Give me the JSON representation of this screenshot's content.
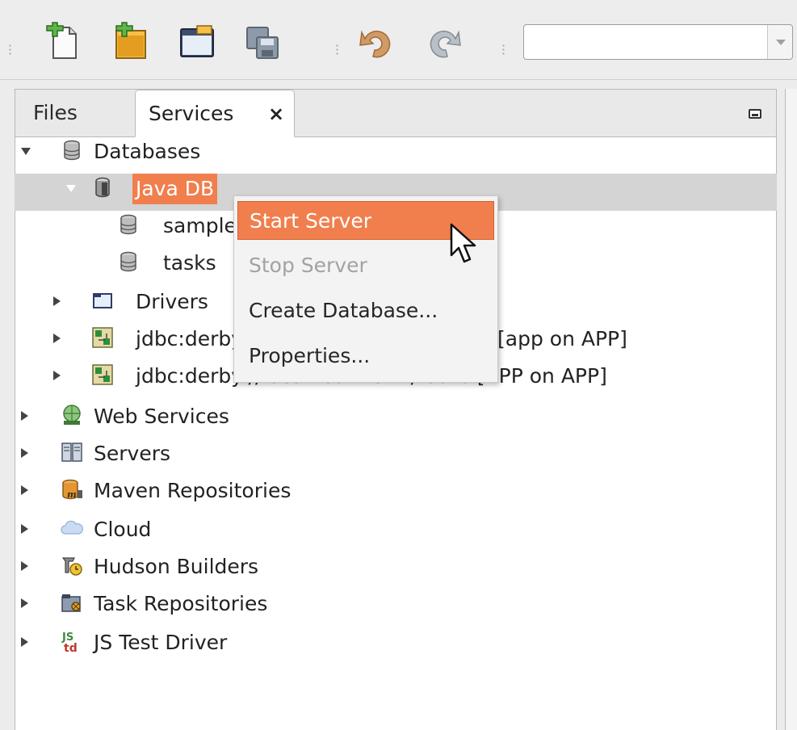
{
  "toolbar": {
    "buttons": [
      {
        "name": "new-file-icon"
      },
      {
        "name": "new-project-icon"
      },
      {
        "name": "open-project-icon"
      },
      {
        "name": "save-all-icon"
      },
      {
        "name": "undo-icon"
      },
      {
        "name": "redo-icon"
      }
    ],
    "search_value": ""
  },
  "tabs": [
    {
      "label": "Files",
      "active": false
    },
    {
      "label": "Services",
      "active": true,
      "close": "×"
    }
  ],
  "tree": [
    {
      "label": "Databases",
      "icon": "database-icon",
      "depth": 0,
      "expanded": true
    },
    {
      "label": "Java DB",
      "icon": "java-db-icon",
      "depth": 1,
      "expanded": true,
      "selected": true
    },
    {
      "label": "sample",
      "icon": "database-icon",
      "depth": 2
    },
    {
      "label": "tasks",
      "icon": "database-icon",
      "depth": 2
    },
    {
      "label": "Drivers",
      "icon": "folder-icon",
      "depth": 1,
      "expanded": false
    },
    {
      "label": "jdbc:derby://localhost:1527/sample [app on APP]",
      "icon": "connection-icon",
      "depth": 1,
      "expanded": false
    },
    {
      "label": "jdbc:derby://localhost:1527/tasks [APP on APP]",
      "icon": "connection-icon",
      "depth": 1,
      "expanded": false
    },
    {
      "label": "Web Services",
      "icon": "web-services-icon",
      "depth": 0,
      "expanded": false
    },
    {
      "label": "Servers",
      "icon": "servers-icon",
      "depth": 0,
      "expanded": false
    },
    {
      "label": "Maven Repositories",
      "icon": "maven-icon",
      "depth": 0,
      "expanded": false
    },
    {
      "label": "Cloud",
      "icon": "cloud-icon",
      "depth": 0,
      "expanded": false
    },
    {
      "label": "Hudson Builders",
      "icon": "hudson-icon",
      "depth": 0,
      "expanded": false
    },
    {
      "label": "Task Repositories",
      "icon": "task-repository-icon",
      "depth": 0,
      "expanded": false
    },
    {
      "label": "JS Test Driver",
      "icon": "js-test-driver-icon",
      "depth": 0,
      "expanded": false
    }
  ],
  "context_menu": {
    "items": [
      {
        "label": "Start Server",
        "state": "active"
      },
      {
        "label": "Stop Server",
        "state": "disabled"
      },
      {
        "label": "Create Database...",
        "state": "normal"
      },
      {
        "label": "Properties...",
        "state": "normal"
      }
    ]
  },
  "colors": {
    "accent": "#f07f4d",
    "selection_row": "#d4d4d4",
    "menu_background": "#f3f3f3"
  }
}
